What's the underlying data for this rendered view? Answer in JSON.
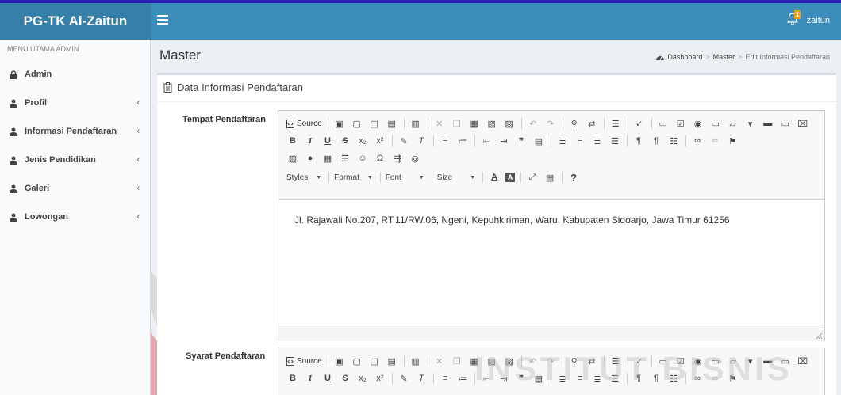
{
  "app": {
    "title": "PG-TK Al-Zaitun",
    "user": "zaitun",
    "notification_count": "1"
  },
  "sidebar": {
    "header": "MENU UTAMA ADMIN",
    "items": [
      {
        "label": "Admin",
        "icon": "lock-icon",
        "has_children": false
      },
      {
        "label": "Profil",
        "icon": "user-icon",
        "has_children": true
      },
      {
        "label": "Informasi Pendaftaran",
        "icon": "user-icon",
        "has_children": true
      },
      {
        "label": "Jenis Pendidikan",
        "icon": "user-icon",
        "has_children": true
      },
      {
        "label": "Galeri",
        "icon": "user-icon",
        "has_children": true
      },
      {
        "label": "Lowongan",
        "icon": "user-icon",
        "has_children": true
      }
    ],
    "chevron": "‹"
  },
  "page": {
    "title": "Master",
    "breadcrumb": [
      "Dashboard",
      "Master",
      "Edit Informasi Pendaftaran"
    ]
  },
  "box": {
    "title": "Data Informasi Pendaftaran"
  },
  "fields": [
    {
      "label": "Tempat Pendaftaran",
      "value": "Jl. Rajawali No.207, RT.11/RW.06, Ngeni, Kepuhkiriman, Waru, Kabupaten Sidoarjo, Jawa Timur 61256"
    },
    {
      "label": "Syarat Pendaftaran",
      "value": ""
    }
  ],
  "editor": {
    "source_label": "Source",
    "combos": [
      "Styles",
      "Format",
      "Font",
      "Size"
    ],
    "help": "?"
  },
  "watermark": "INSTITUT BISNIS",
  "colors": {
    "navbar": "#3c8dbc",
    "logo": "#367fa9",
    "topline": "#2f1fb8",
    "badge": "#f39c12",
    "watermark_red": "#d9232e"
  }
}
